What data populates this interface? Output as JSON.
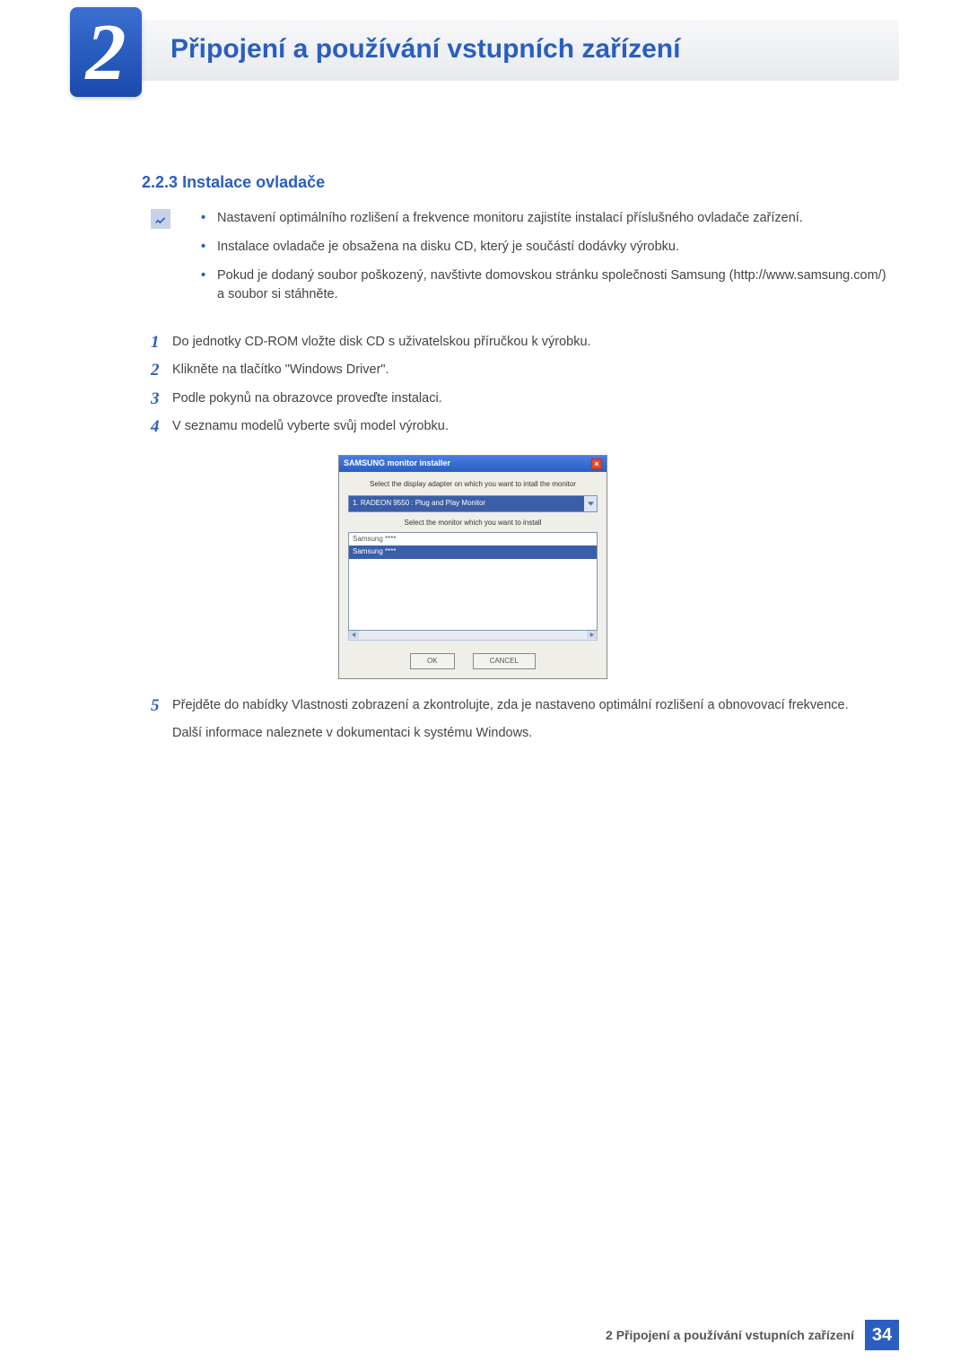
{
  "header": {
    "chapter_number": "2",
    "chapter_title": "Připojení a používání vstupních zařízení"
  },
  "section": {
    "number": "2.2.3",
    "title": "Instalace ovladače"
  },
  "note_items": [
    "Nastavení optimálního rozlišení a frekvence monitoru zajistíte instalací příslušného ovladače zařízení.",
    "Instalace ovladače je obsažena na disku CD, který je součástí dodávky výrobku.",
    "Pokud je dodaný soubor poškozený, navštivte domovskou stránku společnosti Samsung (http://www.samsung.com/) a soubor si stáhněte."
  ],
  "steps": [
    {
      "n": "1",
      "text": "Do jednotky CD-ROM vložte disk CD s uživatelskou příručkou k výrobku."
    },
    {
      "n": "2",
      "text": "Klikněte na tlačítko \"Windows Driver\"."
    },
    {
      "n": "3",
      "text": "Podle pokynů na obrazovce proveďte instalaci."
    },
    {
      "n": "4",
      "text": "V seznamu modelů vyberte svůj model výrobku."
    },
    {
      "n": "5",
      "text": "Přejděte do nabídky Vlastnosti zobrazení a zkontrolujte, zda je nastaveno optimální rozlišení a obnovovací frekvence.",
      "extra": "Další informace naleznete v dokumentaci k systému Windows."
    }
  ],
  "installer": {
    "title": "SAMSUNG monitor installer",
    "label_adapter": "Select the display adapter on which you want to intall the monitor",
    "adapter_value": "1. RADEON 9550 : Plug and Play Monitor",
    "label_monitor": "Select the monitor which you want to install",
    "list": [
      "Samsung ****",
      "Samsung ****"
    ],
    "ok": "OK",
    "cancel": "CANCEL"
  },
  "footer": {
    "title": "2 Připojení a používání vstupních zařízení",
    "page": "34"
  }
}
